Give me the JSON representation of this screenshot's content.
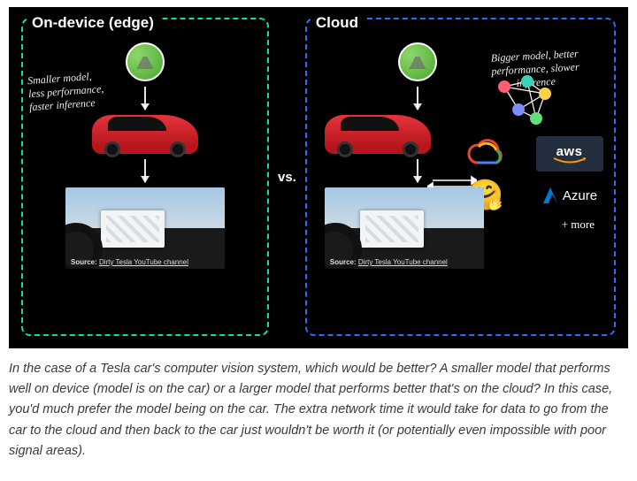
{
  "diagram": {
    "left": {
      "title": "On-device (edge)",
      "handwriting": "Smaller model,\nless performance,\nfaster inference",
      "source_prefix": "Source: ",
      "source_link": "Dirty Tesla YouTube channel"
    },
    "vs": "vs.",
    "right": {
      "title": "Cloud",
      "handwriting": "Bigger model, better\nperformance, slower\ninference",
      "source_prefix": "Source: ",
      "source_link": "Dirty Tesla YouTube channel",
      "providers": {
        "aws": "aws",
        "azure": "Azure",
        "more": "+ more"
      }
    }
  },
  "caption": "In the case of a Tesla car's computer vision system, which would be better? A smaller model that performs well on device (model is on the car) or a larger model that performs better that's on the cloud? In this case, you'd much prefer the model being on the car. The extra network time it would take for data to go from the car to the cloud and then back to the car just wouldn't be worth it (or potentially even impossible with poor signal areas)."
}
